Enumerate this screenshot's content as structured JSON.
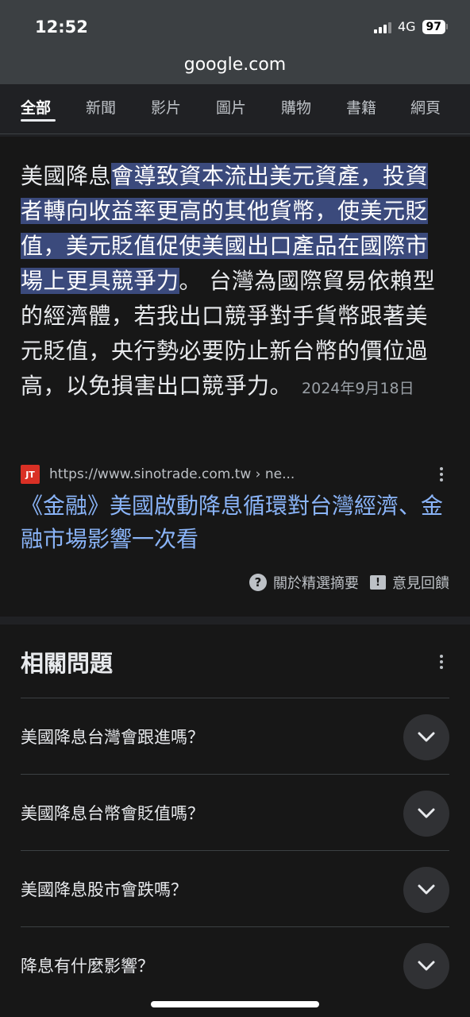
{
  "status": {
    "time": "12:52",
    "network": "4G",
    "battery": "97"
  },
  "browser": {
    "url": "google.com"
  },
  "tabs": [
    "全部",
    "新聞",
    "影片",
    "圖片",
    "購物",
    "書籍",
    "網頁"
  ],
  "featured": {
    "snippet_plain_start": "美國降息",
    "snippet_highlight": "會導致資本流出美元資產，投資者轉向收益率更高的其他貨幣，使美元貶值，美元貶值促使美國出口產品在國際市場上更具競爭力",
    "snippet_plain_end": "。 台灣為國際貿易依賴型的經濟體，若我出口競爭對手貨幣跟著美元貶值，央行勢必要防止新台幣的價位過高，以免損害出口競爭力。",
    "date": "2024年9月18日",
    "favicon_text": "JT",
    "source_url": "https://www.sinotrade.com.tw › ne...",
    "result_title": "《金融》美國啟動降息循環對台灣經濟、金融市場影響一次看",
    "about_label": "關於精選摘要",
    "feedback_label": "意見回饋"
  },
  "related": {
    "title": "相關問題",
    "questions": [
      "美國降息台灣會跟進嗎？",
      "美國降息台幣會貶值嗎？",
      "美國降息股市會跌嗎？",
      "降息有什麼影響？"
    ]
  }
}
